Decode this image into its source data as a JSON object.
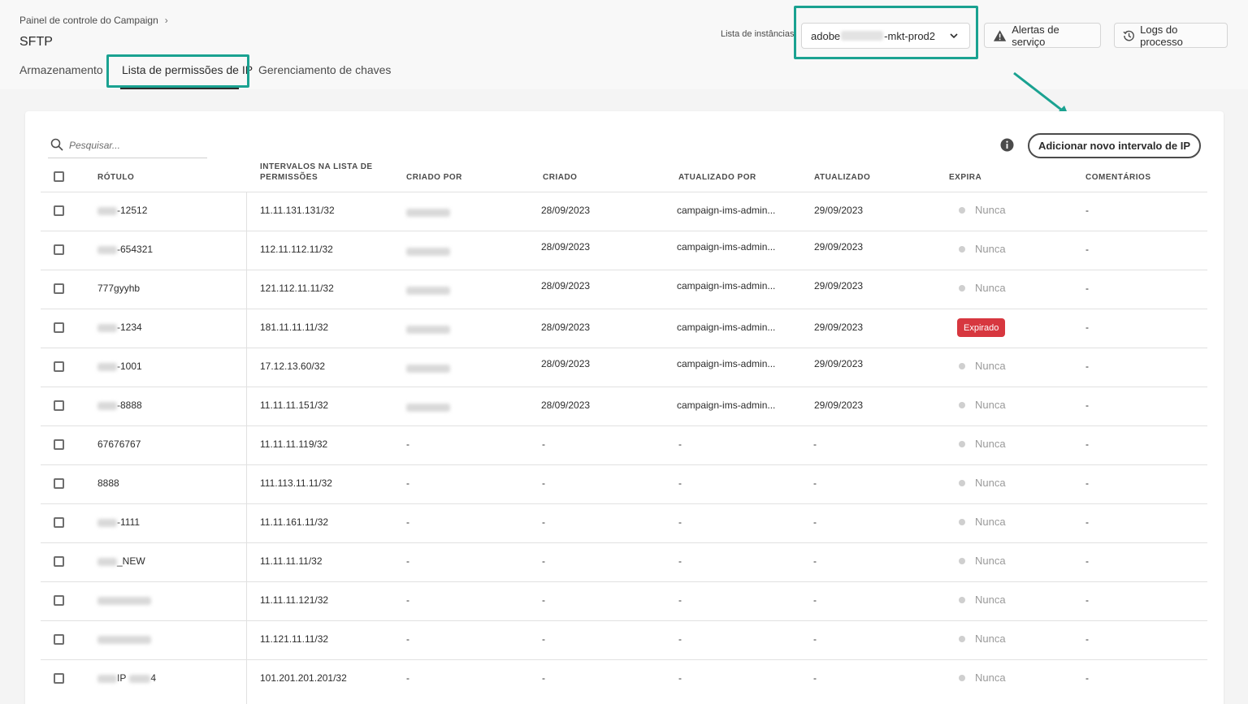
{
  "header": {
    "breadcrumb": "Painel de controle do Campaign",
    "title": "SFTP",
    "tabs": [
      {
        "label": "Armazenamento"
      },
      {
        "label": "Lista de permissões de IP"
      },
      {
        "label": "Gerenciamento de chaves"
      }
    ],
    "instance_label": "Lista de instâncias",
    "instance_prefix": "adobe",
    "instance_suffix": "-mkt-prod2",
    "service_alerts": "Alertas de serviço",
    "process_logs": "Logs do processo"
  },
  "toolbar": {
    "search_placeholder": "Pesquisar...",
    "add_button": "Adicionar novo intervalo de IP"
  },
  "table": {
    "columns": {
      "label": "RÓTULO",
      "ranges_1": "INTERVALOS NA LISTA DE",
      "ranges_2": "PERMISSÕES",
      "created_by": "CRIADO POR",
      "created": "CRIADO",
      "updated_by": "ATUALIZADO POR",
      "updated": "ATUALIZADO",
      "expires": "EXPIRA",
      "comments": "COMENTÁRIOS"
    },
    "rows": [
      {
        "label": "-12512",
        "blur_prefix": true,
        "range": "11.11.131.131/32",
        "created_by_blur": true,
        "created": "28/09/2023",
        "updated_by": "campaign-ims-admin...",
        "updated": "29/09/2023",
        "expires": "Nunca",
        "expired": false,
        "comments": "-"
      },
      {
        "label": "-654321",
        "blur_prefix": true,
        "range": "112.11.112.11/32",
        "created_by_blur": true,
        "created": "28/09/2023",
        "updated_by": "campaign-ims-admin...",
        "updated": "29/09/2023",
        "expires": "Nunca",
        "expired": false,
        "comments": "-"
      },
      {
        "label": "777gyyhb",
        "blur_prefix": false,
        "range": "121.112.11.11/32",
        "created_by_blur": true,
        "created": "28/09/2023",
        "updated_by": "campaign-ims-admin...",
        "updated": "29/09/2023",
        "expires": "Nunca",
        "expired": false,
        "comments": "-"
      },
      {
        "label": "-1234",
        "blur_prefix": true,
        "range": "181.11.11.11/32",
        "created_by_blur": true,
        "created": "28/09/2023",
        "updated_by": "campaign-ims-admin...",
        "updated": "29/09/2023",
        "expires": "Expirado",
        "expired": true,
        "comments": "-"
      },
      {
        "label": "-1001",
        "blur_prefix": true,
        "range": "17.12.13.60/32",
        "created_by_blur": true,
        "created": "28/09/2023",
        "updated_by": "campaign-ims-admin...",
        "updated": "29/09/2023",
        "expires": "Nunca",
        "expired": false,
        "comments": "-"
      },
      {
        "label": "-8888",
        "blur_prefix": true,
        "range": "11.11.11.151/32",
        "created_by_blur": true,
        "created": "28/09/2023",
        "updated_by": "campaign-ims-admin...",
        "updated": "29/09/2023",
        "expires": "Nunca",
        "expired": false,
        "comments": "-"
      },
      {
        "label": "67676767",
        "blur_prefix": false,
        "range": "11.11.11.119/32",
        "created_by_blur": false,
        "created_by": "-",
        "created": "-",
        "updated_by": "-",
        "updated": "-",
        "expires": "Nunca",
        "expired": false,
        "comments": "-"
      },
      {
        "label": "8888",
        "blur_prefix": false,
        "range": "111.113.11.11/32",
        "created_by_blur": false,
        "created_by": "-",
        "created": "-",
        "updated_by": "-",
        "updated": "-",
        "expires": "Nunca",
        "expired": false,
        "comments": "-"
      },
      {
        "label": "-1111",
        "blur_prefix": true,
        "range": "11.11.161.11/32",
        "created_by_blur": false,
        "created_by": "-",
        "created": "-",
        "updated_by": "-",
        "updated": "-",
        "expires": "Nunca",
        "expired": false,
        "comments": "-"
      },
      {
        "label": "_NEW",
        "blur_prefix": true,
        "range": "11.11.11.11/32",
        "created_by_blur": false,
        "created_by": "-",
        "created": "-",
        "updated_by": "-",
        "updated": "-",
        "expires": "Nunca",
        "expired": false,
        "comments": "-"
      },
      {
        "label": "",
        "blur_prefix": true,
        "blur_wide": true,
        "range": "11.11.11.121/32",
        "created_by_blur": false,
        "created_by": "-",
        "created": "-",
        "updated_by": "-",
        "updated": "-",
        "expires": "Nunca",
        "expired": false,
        "comments": "-"
      },
      {
        "label": "",
        "blur_prefix": true,
        "blur_wide": true,
        "range": "11.121.11.11/32",
        "created_by_blur": false,
        "created_by": "-",
        "created": "-",
        "updated_by": "-",
        "updated": "-",
        "expires": "Nunca",
        "expired": false,
        "comments": "-"
      },
      {
        "label": "IP",
        "label_tail": "4",
        "blur_prefix": true,
        "blur_mid": true,
        "range": "101.201.201.201/32",
        "created_by_blur": false,
        "created_by": "-",
        "created": "-",
        "updated_by": "-",
        "updated": "-",
        "expires": "Nunca",
        "expired": false,
        "comments": "-"
      }
    ]
  },
  "colors": {
    "highlight": "#1aa291",
    "expired_badge": "#d7373f"
  }
}
